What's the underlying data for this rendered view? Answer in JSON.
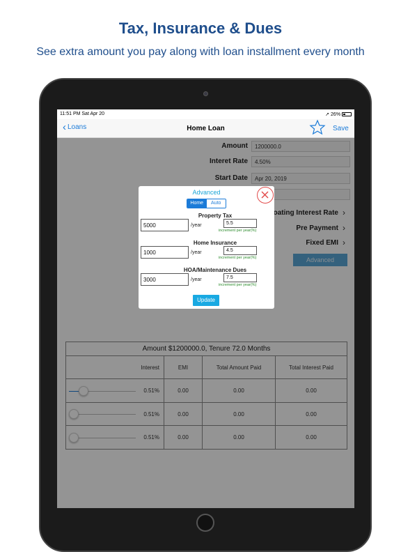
{
  "promo": {
    "headline": "Tax, Insurance & Dues",
    "subline": "See extra amount you pay along with loan installment every month"
  },
  "status": {
    "time_date": "11:51 PM   Sat Apr 20",
    "battery": "26%"
  },
  "nav": {
    "back_label": "Loans",
    "title": "Home Loan",
    "save_label": "Save"
  },
  "form": {
    "amount_label": "Amount",
    "amount_value": "1200000.0",
    "rate_label": "Interet Rate",
    "rate_value": "4.50%",
    "start_label": "Start Date",
    "start_value": "Apr 20, 2019",
    "floating_label": "loating Interest Rate",
    "prepayment_label": "Pre Payment",
    "fixed_emi_label": "Fixed EMI",
    "advanced_button": "Advanced"
  },
  "results": {
    "title": "Amount $1200000.0, Tenure 72.0 Months",
    "headers": [
      "Interest",
      "EMI",
      "Total Amount Paid",
      "Total Interest Paid"
    ],
    "rows": [
      {
        "interest": "0.51%",
        "emi": "0.00",
        "total_paid": "0.00",
        "total_interest": "0.00",
        "slider_level": 0.22
      },
      {
        "interest": "0.51%",
        "emi": "0.00",
        "total_paid": "0.00",
        "total_interest": "0.00",
        "slider_level": 0.0
      },
      {
        "interest": "0.51%",
        "emi": "0.00",
        "total_paid": "0.00",
        "total_interest": "0.00",
        "slider_level": 0.0
      }
    ]
  },
  "modal": {
    "title": "Advanced",
    "seg_home": "Home",
    "seg_auto": "Auto",
    "property_tax_label": "Property Tax",
    "property_tax_value": "5000",
    "property_tax_pct": "5.5",
    "home_insurance_label": "Home Insurance",
    "home_insurance_value": "1000",
    "home_insurance_pct": "4.5",
    "hoa_label": "HOA/Maintenance Dues",
    "hoa_value": "3000",
    "hoa_pct": "7.5",
    "unit": "/year",
    "hint": "increment per year(%)",
    "update_button": "Update"
  },
  "colors": {
    "accent": "#1b7bd8",
    "headline": "#1f4e8c",
    "close": "#e24b4b",
    "update": "#19a9e2"
  }
}
